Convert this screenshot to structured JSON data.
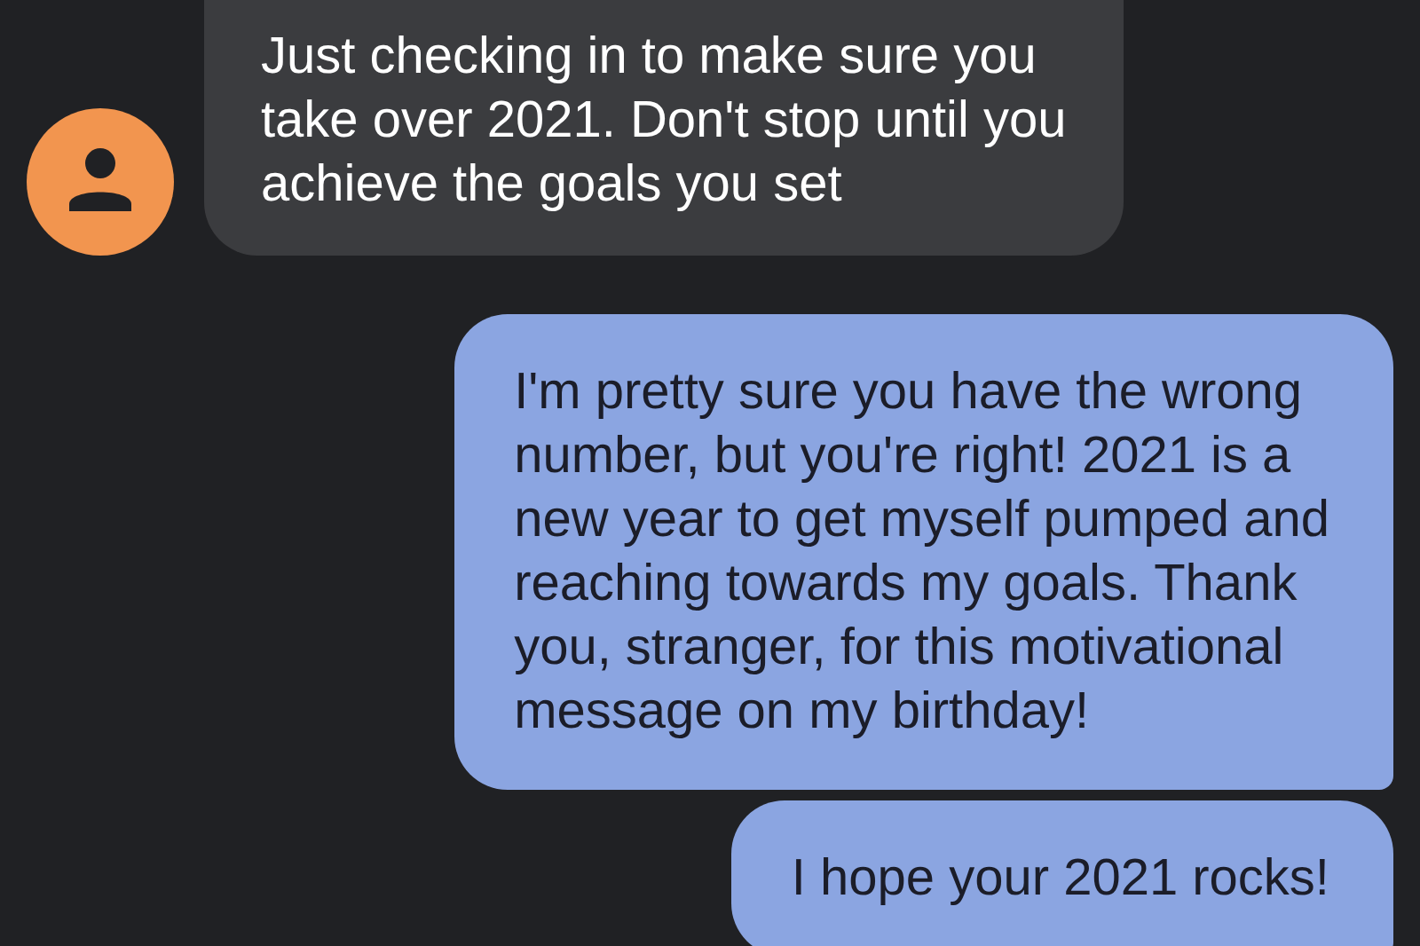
{
  "messages": [
    {
      "kind": "incoming",
      "text": "Just checking in to make sure you\ntake over 2021. Don't stop until you\nachieve the goals you set"
    },
    {
      "kind": "outgoing",
      "text": "I'm pretty sure you have the wrong\nnumber, but you're right! 2021 is a\nnew year to get myself pumped and\nreaching towards my goals. Thank\nyou, stranger, for this motivational\nmessage on my birthday!"
    },
    {
      "kind": "outgoing",
      "text": "I hope your 2021 rocks!"
    }
  ]
}
